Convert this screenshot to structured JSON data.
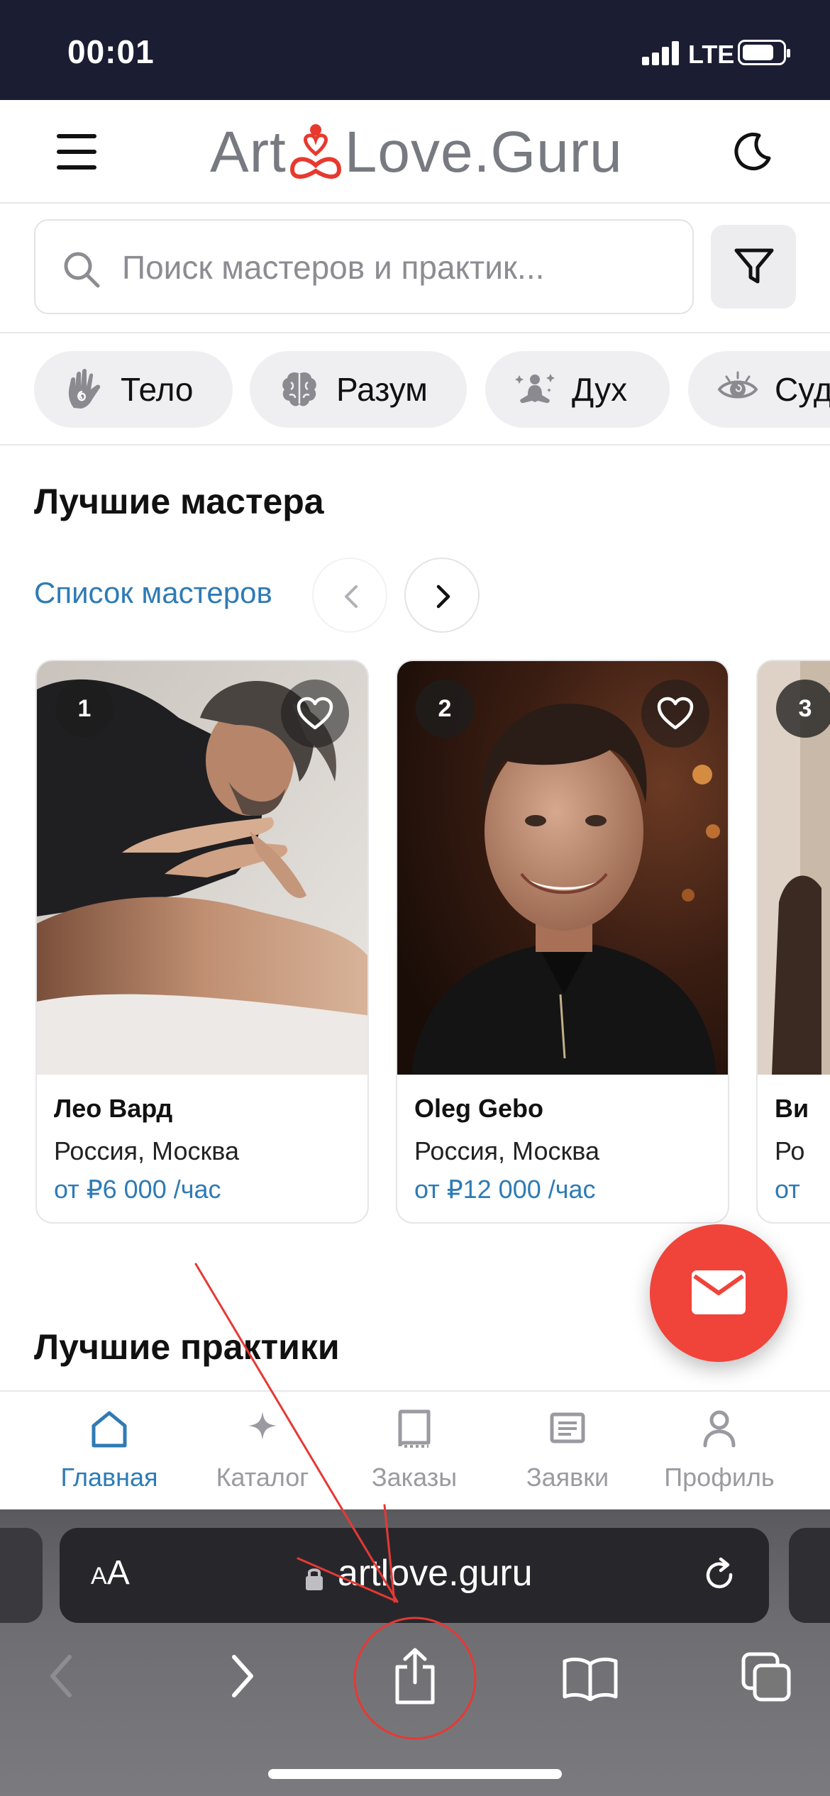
{
  "status_bar": {
    "time": "00:01",
    "network": "LTE",
    "battery_level": 0.8
  },
  "header": {
    "logo_text_left": "Art",
    "logo_text_right": "Love.Guru"
  },
  "search": {
    "placeholder": "Поиск мастеров и практик..."
  },
  "categories": [
    {
      "label": "Тело",
      "icon": "hand-spiral-icon"
    },
    {
      "label": "Разум",
      "icon": "brain-icon"
    },
    {
      "label": "Дух",
      "icon": "meditation-icon"
    },
    {
      "label": "Судьба",
      "icon": "eye-icon"
    }
  ],
  "masters_section": {
    "title": "Лучшие мастера",
    "link": "Список мастеров",
    "cards": [
      {
        "rank": "1",
        "name": "Лео Вард",
        "city": "Россия, Москва",
        "price": "от ₽6 000 /час"
      },
      {
        "rank": "2",
        "name": "Oleg Gebo",
        "city": "Россия, Москва",
        "price": "от ₽12 000 /час"
      },
      {
        "rank": "3",
        "name": "Ви",
        "city": "Ро",
        "price": "от"
      }
    ]
  },
  "practices_section": {
    "title": "Лучшие практики"
  },
  "bottom_nav": [
    {
      "label": "Главная",
      "icon": "home-icon",
      "active": true
    },
    {
      "label": "Каталог",
      "icon": "sparkle-icon",
      "active": false
    },
    {
      "label": "Заказы",
      "icon": "book-icon",
      "active": false
    },
    {
      "label": "Заявки",
      "icon": "list-icon",
      "active": false
    },
    {
      "label": "Профиль",
      "icon": "user-icon",
      "active": false
    }
  ],
  "browser": {
    "aa_label_small": "A",
    "aa_label_big": "A",
    "url": "artlove.guru"
  },
  "colors": {
    "accent": "#2e7bb5",
    "brand_red": "#e8392f",
    "fab": "#f0433a",
    "status_bar": "#1b1d33",
    "annotation": "#e53935"
  }
}
